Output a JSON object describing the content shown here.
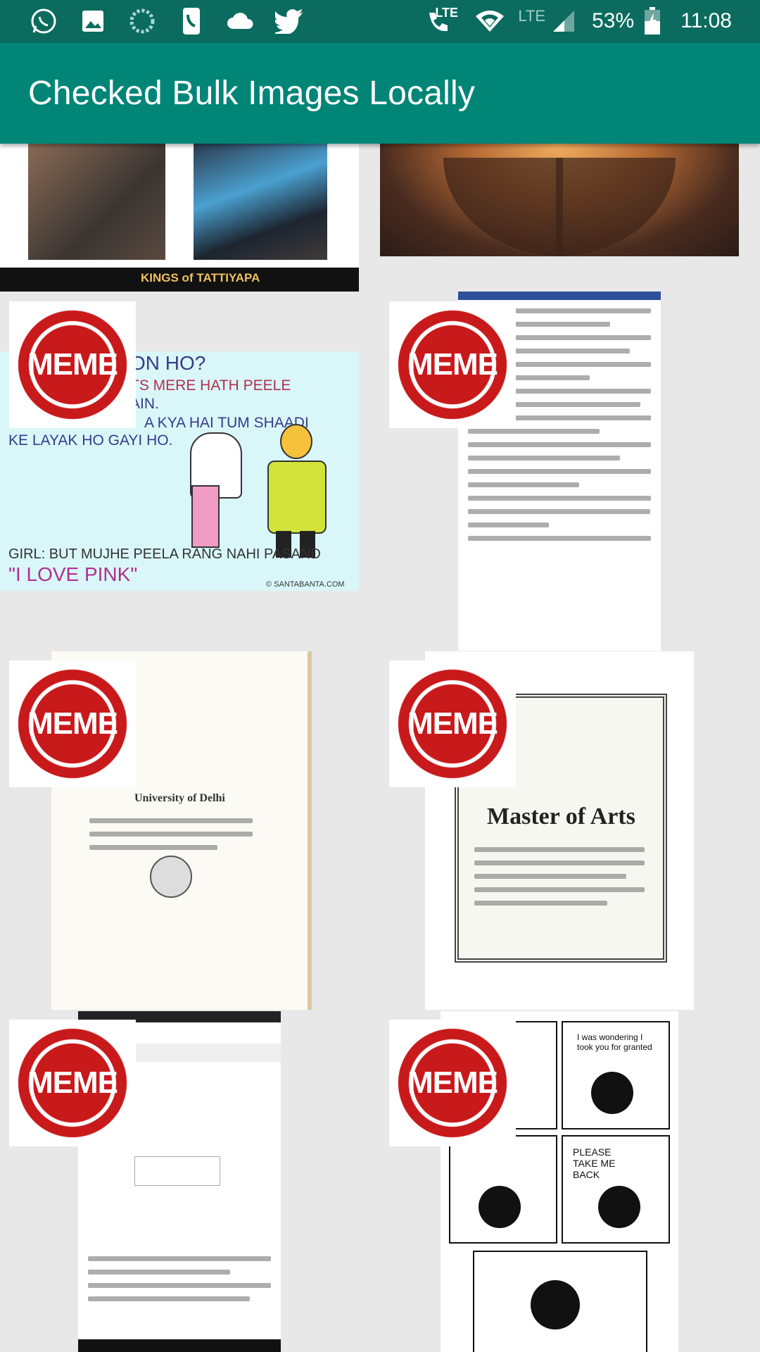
{
  "status_bar": {
    "left_icons": [
      "whatsapp-icon",
      "gallery-icon",
      "loading-icon",
      "phone-icon",
      "cloud-icon",
      "twitter-icon"
    ],
    "lte_call": "LTE",
    "lte_label": "LTE",
    "battery": "53%",
    "time": "11:08"
  },
  "app_bar": {
    "title": "Checked Bulk Images Locally"
  },
  "stamp_label": "MEME",
  "images": {
    "wrestling_caption": "KINGS of TATTIYAPA",
    "meme_q": "ON HO?",
    "meme_line1": "TS MERE HATH PEELE",
    "meme_line2": "AIN.",
    "meme_line3": "A KYA HAI TUM SHAADI",
    "meme_line4": "KE LAYAK HO GAYI HO.",
    "meme_line5": "GIRL: BUT MUJHE PEELA RANG NAHI PASAND",
    "meme_line6": "\"I LOVE PINK\"",
    "meme_credit": "© SANTABANTA.COM",
    "degree_title": "Master of Arts",
    "degree_uni": "University of Delhi",
    "comic_1": "I was wondering I took you for granted",
    "comic_2": "PLEASE TAKE ME BACK"
  },
  "colors": {
    "status_bar": "#0b6b5f",
    "app_bar": "#008577",
    "stamp_red": "#c8191b",
    "background": "#e8e8e8"
  }
}
